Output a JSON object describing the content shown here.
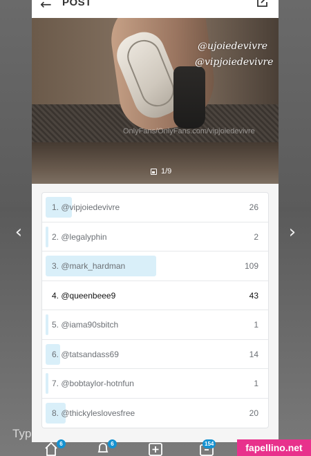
{
  "header": {
    "title": "POST"
  },
  "image": {
    "watermark_primary": "@ujoiedevivre",
    "watermark_secondary": "@vipjoiedevivre",
    "watermark_overlay": "OnlyFans/OnlyFans.com/vipjoiedevivre",
    "counter": "1/9"
  },
  "ranking": {
    "max_value": 109,
    "rows": [
      {
        "label": "1. @vipjoiedevivre",
        "count": "26",
        "value": 26,
        "highlight": false
      },
      {
        "label": "2. @legalyphin",
        "count": "2",
        "value": 2,
        "highlight": false
      },
      {
        "label": "3. @mark_hardman",
        "count": "109",
        "value": 109,
        "highlight": false
      },
      {
        "label": "4. @queenbeee9",
        "count": "43",
        "value": 43,
        "highlight": true
      },
      {
        "label": "5. @iama90sbitch",
        "count": "1",
        "value": 1,
        "highlight": false
      },
      {
        "label": "6. @tatsandass69",
        "count": "14",
        "value": 14,
        "highlight": false
      },
      {
        "label": "7. @bobtaylor-hotnfun",
        "count": "1",
        "value": 1,
        "highlight": false
      },
      {
        "label": "8. @thickyleslovesfree",
        "count": "20",
        "value": 20,
        "highlight": false
      }
    ]
  },
  "footer": {
    "input_placeholder": "Typ",
    "tabs": [
      {
        "icon": "home-icon",
        "badge": "6"
      },
      {
        "icon": "bell-icon",
        "badge": "6"
      },
      {
        "icon": "add-icon",
        "badge": ""
      },
      {
        "icon": "messages-icon",
        "badge": "154"
      }
    ],
    "brand": "fapellino.net"
  },
  "colors": {
    "accent": "#1592d1",
    "bar": "#d9eff9",
    "brand": "#e8318c"
  }
}
